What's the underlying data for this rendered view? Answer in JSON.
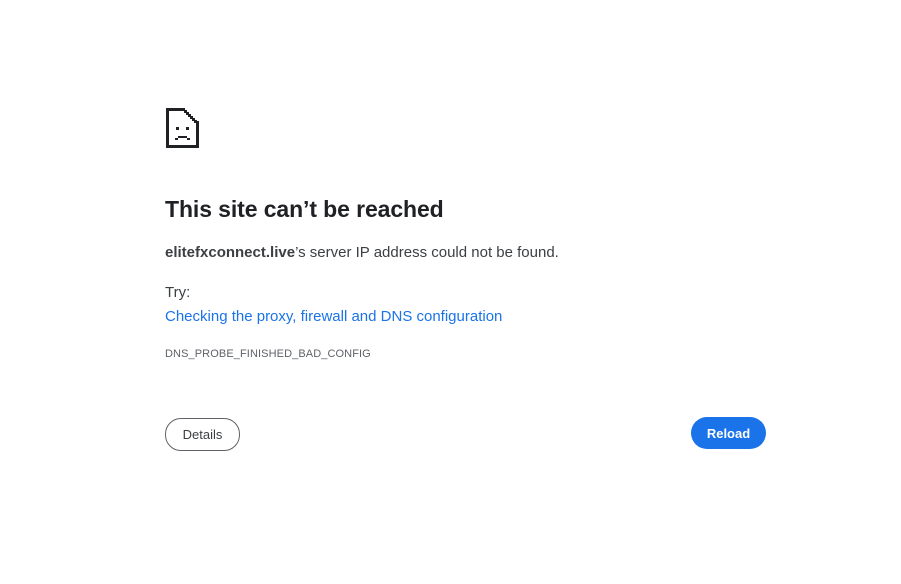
{
  "icon": "sad-document-icon",
  "error": {
    "title": "This site can’t be reached",
    "host": "elitefxconnect.live",
    "message": "’s server IP address could not be found.",
    "try_label": "Try:",
    "suggestion_link": "Checking the proxy, firewall and DNS configuration",
    "code": "DNS_PROBE_FINISHED_BAD_CONFIG"
  },
  "buttons": {
    "details": "Details",
    "reload": "Reload"
  },
  "colors": {
    "link": "#1a73e8",
    "primary_button": "#1a73e8",
    "text": "#202124"
  }
}
